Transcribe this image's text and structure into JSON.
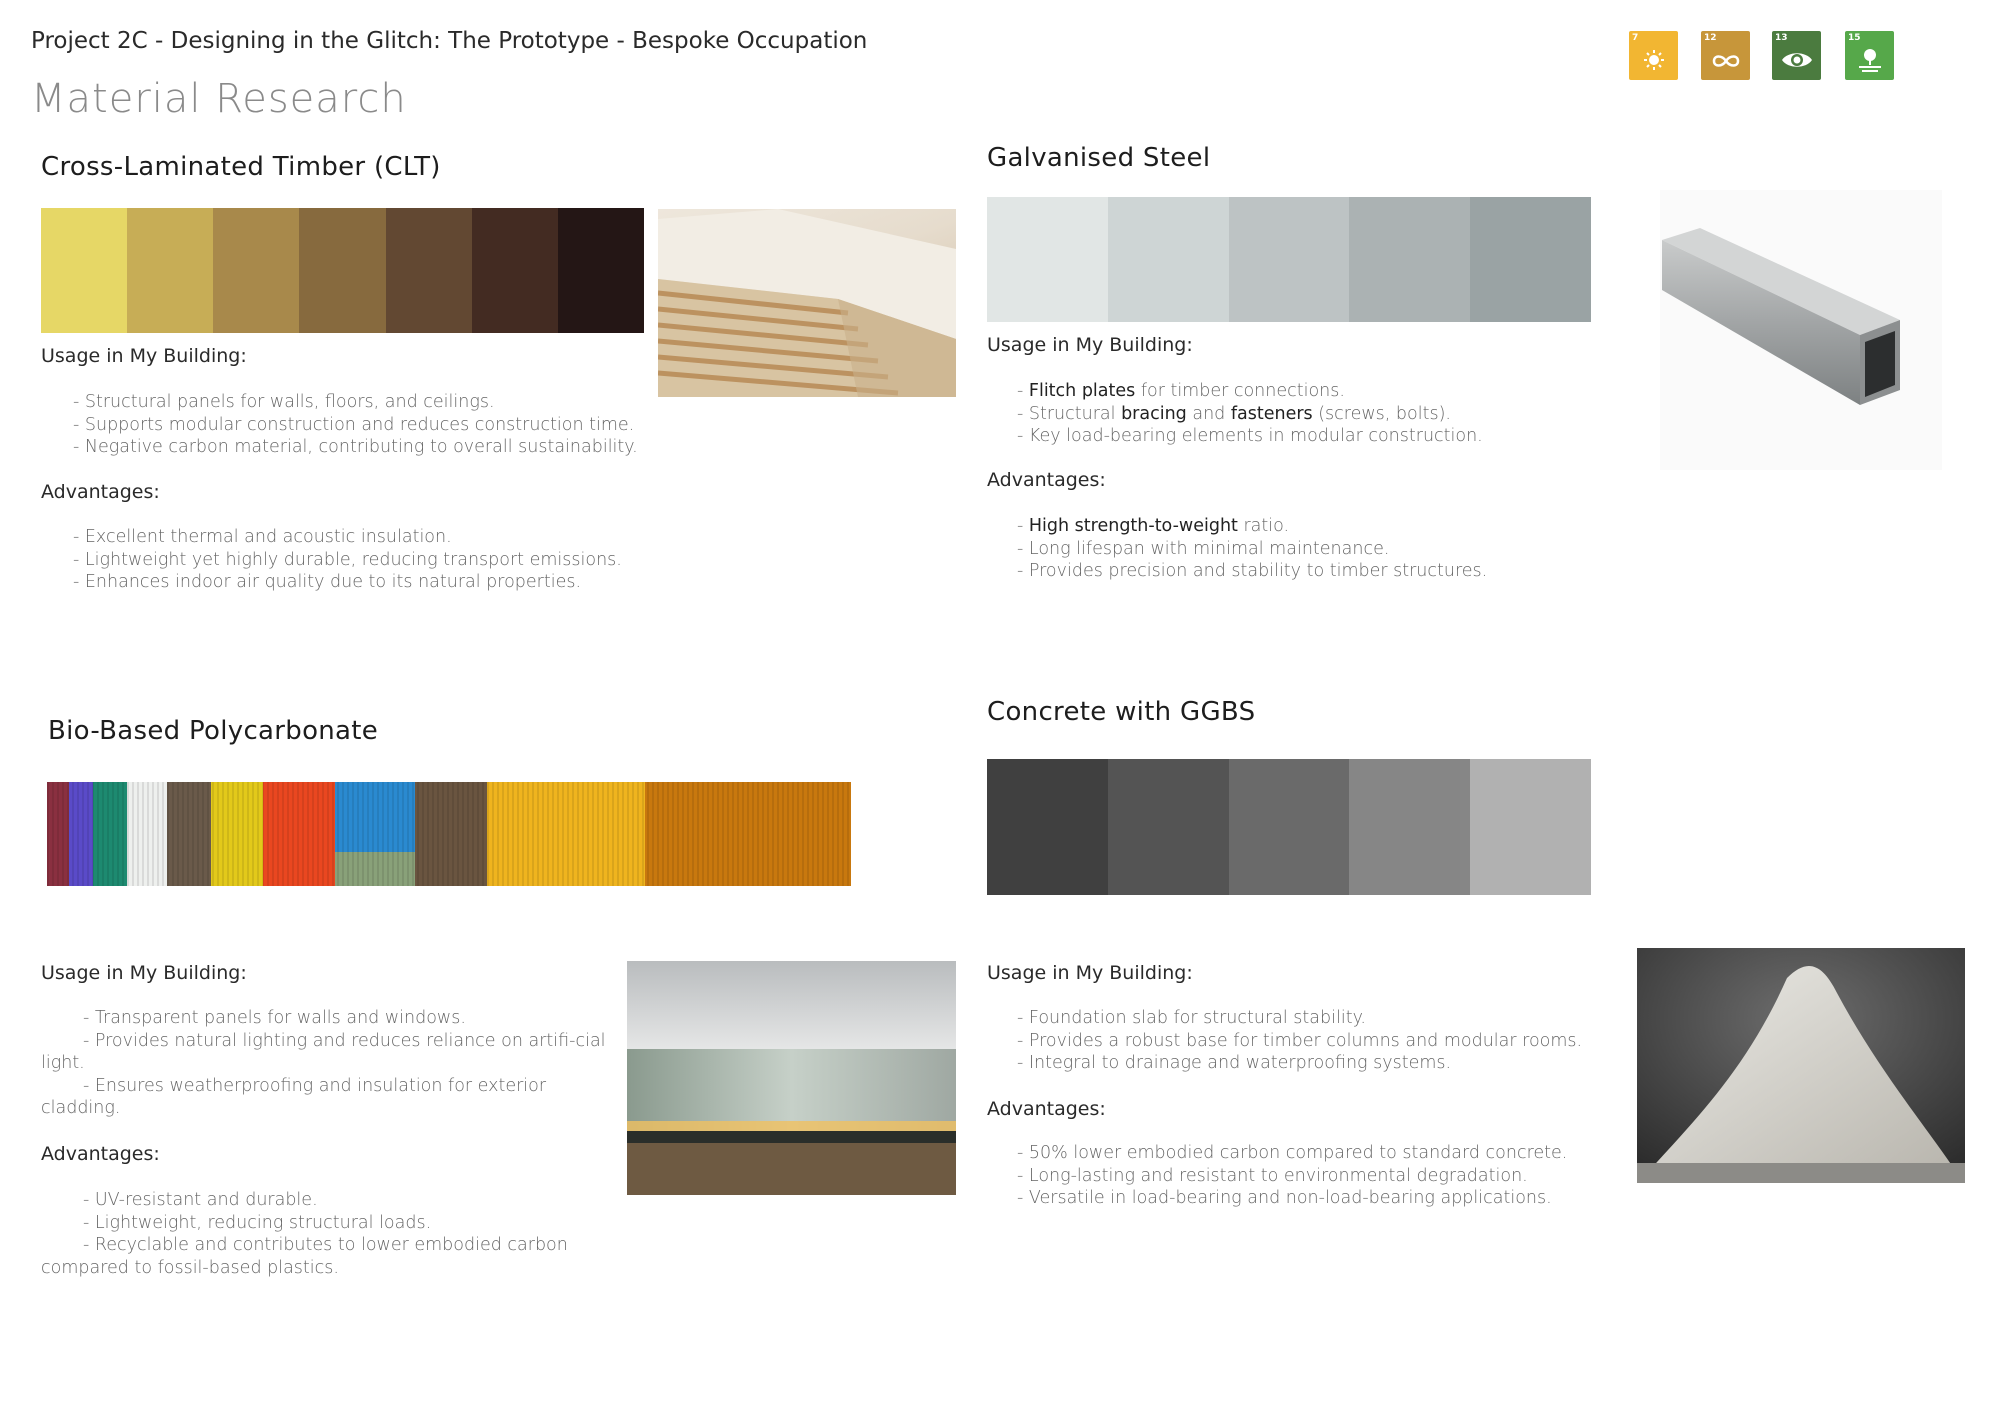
{
  "header": {
    "project_title": "Project 2C - Designing in the Glitch: The Prototype - Bespoke Occupation",
    "page_title": "Material Research"
  },
  "sdg_icons": [
    {
      "number": "7",
      "icon": "sun-icon",
      "color": "#F2B632"
    },
    {
      "number": "12",
      "icon": "infinity-icon",
      "color": "#C7963A"
    },
    {
      "number": "13",
      "icon": "eye-globe-icon",
      "color": "#4B7B3F"
    },
    {
      "number": "15",
      "icon": "tree-icon",
      "color": "#56A84A"
    }
  ],
  "clt": {
    "title": "Cross-Laminated Timber (CLT)",
    "swatches": [
      "#E6D766",
      "#C7AD56",
      "#A8894B",
      "#876A3E",
      "#624832",
      "#432B22",
      "#241615"
    ],
    "usage_label": "Usage in My Building:",
    "usage": [
      "- Structural panels for walls, floors, and ceilings.",
      "- Supports modular construction and reduces construction time.",
      "- Negative carbon material, contributing to overall sustainability."
    ],
    "advantages_label": "Advantages:",
    "advantages": [
      "- Excellent thermal and acoustic insulation.",
      "- Lightweight yet highly durable, reducing transport emissions.",
      "- Enhances indoor air quality due to its natural properties."
    ]
  },
  "steel": {
    "title": "Galvanised Steel",
    "swatches": [
      "#E1E6E5",
      "#CED5D5",
      "#BDC3C4",
      "#ABB2B3",
      "#9AA3A4"
    ],
    "usage_label": "Usage in My Building:",
    "usage": [
      {
        "pre": "- ",
        "b1": "Flitch plates",
        "m1": " for timber connections.",
        "b2": "",
        "m2": "",
        "b3": "",
        "post": ""
      },
      {
        "pre": "- Structural ",
        "b1": "bracing",
        "m1": " and ",
        "b2": "fasteners",
        "m2": " (screws, bolts).",
        "b3": "",
        "post": ""
      },
      {
        "pre": "- Key load-bearing elements in modular construction.",
        "b1": "",
        "m1": "",
        "b2": "",
        "m2": "",
        "b3": "",
        "post": ""
      }
    ],
    "advantages_label": "Advantages:",
    "advantages": [
      {
        "pre": "- ",
        "b1": "High strength-to-weight",
        "post": " ratio."
      },
      {
        "pre": "- Long lifespan with minimal maintenance.",
        "b1": "",
        "post": ""
      },
      {
        "pre": "- Provides precision and stability to timber structures.",
        "b1": "",
        "post": ""
      }
    ]
  },
  "poly": {
    "title": "Bio-Based Polycarbonate",
    "usage_label": "Usage in My Building:",
    "usage": [
      "- Transparent panels for walls and windows.",
      "- Provides natural lighting and reduces reliance on artifi-cial light.",
      "- Ensures weatherproofing and insulation for exterior cladding."
    ],
    "advantages_label": "Advantages:",
    "advantages": [
      "- UV-resistant and durable.",
      "- Lightweight, reducing structural loads.",
      "- Recyclable and contributes to lower embodied carbon compared to fossil-based plastics."
    ]
  },
  "concrete": {
    "title": "Concrete with GGBS",
    "swatches": [
      "#404040",
      "#545454",
      "#6A6A6A",
      "#868686",
      "#B1B1B1"
    ],
    "usage_label": "Usage in My Building:",
    "usage": [
      "- Foundation slab for structural stability.",
      "- Provides a robust base for timber columns and modular rooms.",
      "- Integral to drainage and waterproofing systems."
    ],
    "advantages_label": "Advantages:",
    "advantages": [
      "- 50% lower embodied carbon compared to standard concrete.",
      "- Long-lasting and resistant to environmental degradation.",
      "- Versatile in load-bearing and non-load-bearing applications."
    ]
  }
}
